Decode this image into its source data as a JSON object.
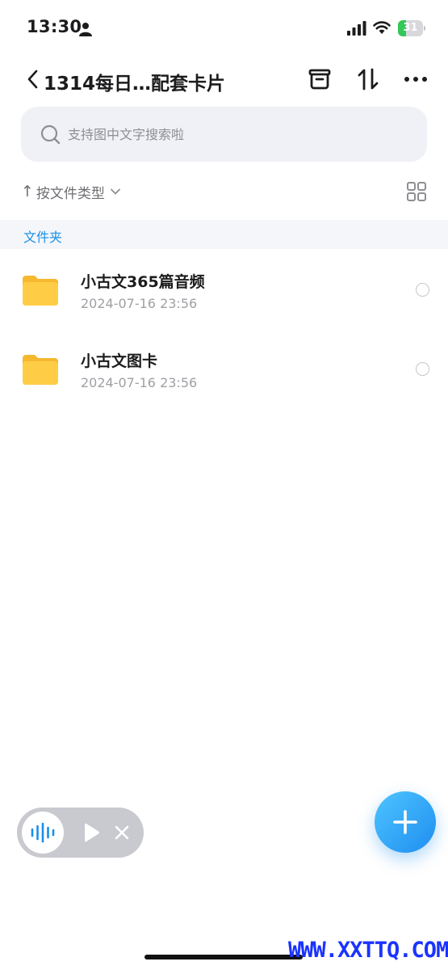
{
  "status_bar": {
    "time": "13:30",
    "battery_level": 31,
    "battery_text": "31",
    "battery_color": "#34c759"
  },
  "nav": {
    "title": "1314每日…配套卡片",
    "icons": [
      "chevron-left-icon",
      "archive-box-icon",
      "sort-arrows-icon",
      "ellipsis-icon"
    ]
  },
  "search": {
    "placeholder": "支持图中文字搜索啦",
    "value": ""
  },
  "sort": {
    "label": "按文件类型",
    "arrow": "↑"
  },
  "section": {
    "label": "文件夹"
  },
  "files": [
    {
      "name": "小古文365篇音频",
      "date": "2024-07-16 23:56"
    },
    {
      "name": "小古文图卡",
      "date": "2024-07-16 23:56"
    }
  ],
  "colors": {
    "accent": "#1a8fe6",
    "folder": "#ffc83d",
    "fab_start": "#4fc4ff",
    "fab_end": "#1e8ef0"
  },
  "watermark": "WWW.XXTTQ.COM"
}
